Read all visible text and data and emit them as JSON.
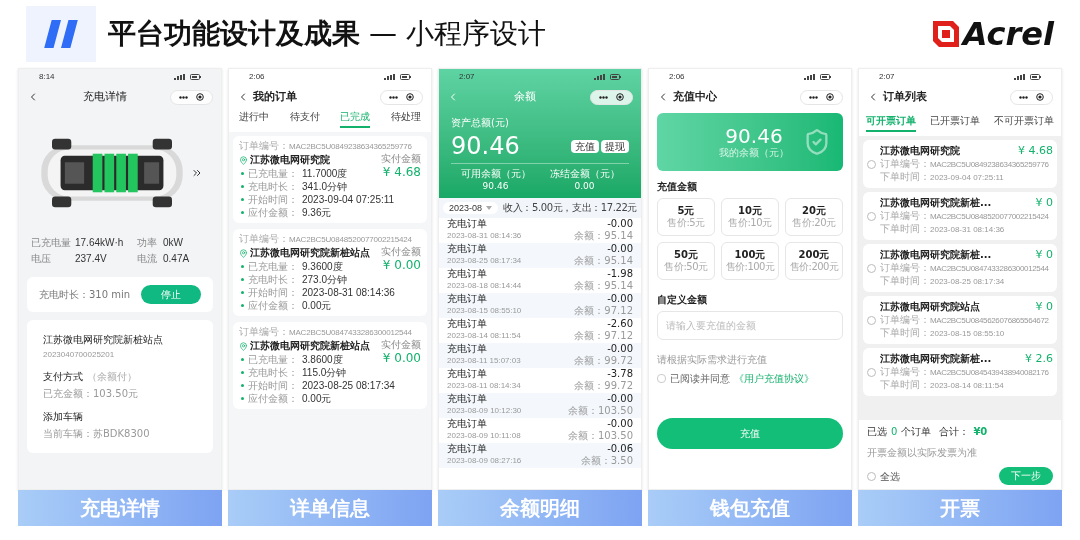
{
  "header": {
    "title": "**平台功能设计及成果** — 小程序设计",
    "logo": "Acrel"
  },
  "screens": [
    {
      "kind": "charge_detail",
      "caption": "充电详情",
      "time": "8:14",
      "title": "充电详情",
      "stats": [
        {
          "label": "已充电量",
          "value": "17.64kW·h"
        },
        {
          "label": "功率",
          "value": "0kW"
        },
        {
          "label": "电压",
          "value": "237.4V"
        },
        {
          "label": "电流",
          "value": "0.47A"
        }
      ],
      "duration": "充电时长：310 min",
      "stop_button": "停止",
      "station": "江苏微电网研究院新桩站点",
      "station_code": "2023040700025201",
      "payment_label": "支付方式",
      "payment_method": "（余额付）",
      "charged_amount": "已充金额：103.50元",
      "vehicle_label": "添加车辆",
      "vehicle": "当前车辆：苏BDK8300"
    },
    {
      "kind": "orders",
      "caption": "详单信息",
      "time": "2:06",
      "title": "我的订单",
      "tabs": [
        {
          "label": "进行中",
          "selected": false
        },
        {
          "label": "待支付",
          "selected": false
        },
        {
          "label": "已完成",
          "selected": true
        },
        {
          "label": "待处理",
          "selected": false
        }
      ],
      "orders": [
        {
          "number_label": "订单编号：",
          "number": "MAC2BC5U0849238634365259776",
          "station": "江苏微电网研究院",
          "paid_label": "实付金额",
          "paid": "¥ 4.68",
          "fields": [
            {
              "label": "已充电量：",
              "value": "11.7000度"
            },
            {
              "label": "充电时长：",
              "value": "341.0分钟"
            },
            {
              "label": "开始时间：",
              "value": "2023-09-04 07:25:11"
            },
            {
              "label": "应付金额：",
              "value": "9.36元"
            }
          ]
        },
        {
          "number_label": "订单编号：",
          "number": "MAC2BC5U0848520077002215424",
          "station": "江苏微电网研究院新桩站点",
          "paid_label": "实付金额",
          "paid": "¥ 0.00",
          "fields": [
            {
              "label": "已充电量：",
              "value": "9.3600度"
            },
            {
              "label": "充电时长：",
              "value": "273.0分钟"
            },
            {
              "label": "开始时间：",
              "value": "2023-08-31 08:14:36"
            },
            {
              "label": "应付金额：",
              "value": "0.00元"
            }
          ]
        },
        {
          "number_label": "订单编号：",
          "number": "MAC2BC5U0847433286300012544",
          "station": "江苏微电网研究院新桩站点",
          "paid_label": "实付金额",
          "paid": "¥ 0.00",
          "fields": [
            {
              "label": "已充电量：",
              "value": "3.8600度"
            },
            {
              "label": "充电时长：",
              "value": "115.0分钟"
            },
            {
              "label": "开始时间：",
              "value": "2023-08-25 08:17:34"
            },
            {
              "label": "应付金额：",
              "value": "0.00元"
            }
          ]
        }
      ]
    },
    {
      "kind": "balance",
      "caption": "余额明细",
      "time": "2:07",
      "title": "余额",
      "total_label": "资产总额(元)",
      "total": "90.46",
      "buttons": [
        "充值",
        "提现"
      ],
      "available_label": "可用余额（元）",
      "available": "90.46",
      "frozen_label": "冻结金额（元）",
      "frozen": "0.00",
      "month": "2023-08",
      "summary": "收入：5.00元，支出：17.22元",
      "rows": [
        {
          "title": "充电订单",
          "time": "2023-08-31 08:14:36",
          "amount": "-0.00",
          "balance": "余额：95.14"
        },
        {
          "title": "充电订单",
          "time": "2023-08-25 08:17:34",
          "amount": "-0.00",
          "balance": "余额：95.14"
        },
        {
          "title": "充电订单",
          "time": "2023-08-18 08:14:44",
          "amount": "-1.98",
          "balance": "余额：95.14"
        },
        {
          "title": "充电订单",
          "time": "2023-08-15 08:55:10",
          "amount": "-0.00",
          "balance": "余额：97.12"
        },
        {
          "title": "充电订单",
          "time": "2023-08-14 08:11:54",
          "amount": "-2.60",
          "balance": "余额：97.12"
        },
        {
          "title": "充电订单",
          "time": "2023-08-11 15:07:03",
          "amount": "-0.00",
          "balance": "余额：99.72"
        },
        {
          "title": "充电订单",
          "time": "2023-08-11 08:14:34",
          "amount": "-3.78",
          "balance": "余额：99.72"
        },
        {
          "title": "充电订单",
          "time": "2023-08-09 10:12:30",
          "amount": "-0.00",
          "balance": "余额：103.50"
        },
        {
          "title": "充电订单",
          "time": "2023-08-09 10:11:08",
          "amount": "-0.00",
          "balance": "余额：103.50"
        },
        {
          "title": "充电订单",
          "time": "2023-08-09 08:27:16",
          "amount": "-0.06",
          "balance": "余额：3.50"
        }
      ]
    },
    {
      "kind": "recharge",
      "caption": "钱包充值",
      "time": "2:06",
      "title": "充值中心",
      "balance": "90.46",
      "balance_label": "我的余额（元）",
      "amount_label": "充值金额",
      "options": [
        {
          "amount": "5元",
          "price": "售价:5元"
        },
        {
          "amount": "10元",
          "price": "售价:10元"
        },
        {
          "amount": "20元",
          "price": "售价:20元"
        },
        {
          "amount": "50元",
          "price": "售价:50元"
        },
        {
          "amount": "100元",
          "price": "售价:100元"
        },
        {
          "amount": "200元",
          "price": "售价:200元"
        }
      ],
      "custom_label": "自定义金额",
      "placeholder": "请输入要充值的金额",
      "hint": "请根据实际需求进行充值",
      "agree_checked": false,
      "agree_text": "已阅读并同意",
      "agreement_link": "《用户充值协议》",
      "submit": "充值"
    },
    {
      "kind": "invoice",
      "caption": "开票",
      "time": "2:07",
      "title": "订单列表",
      "tabs": [
        {
          "label": "可开票订单",
          "selected": true
        },
        {
          "label": "已开票订单",
          "selected": false
        },
        {
          "label": "不可开票订单",
          "selected": false
        }
      ],
      "orders": [
        {
          "station": "江苏微电网研究院",
          "amount": "¥ 4.68",
          "selected": false,
          "number_label": "订单编号：",
          "number": "MAC2BC5U0849238634365259776",
          "time_label": "下单时间：",
          "time": "2023-09-04 07:25:11"
        },
        {
          "station": "江苏微电网研究院新桩...",
          "amount": "¥ 0",
          "selected": false,
          "number_label": "订单编号：",
          "number": "MAC2BC5U0848520077002215424",
          "time_label": "下单时间：",
          "time": "2023-08-31 08:14:36"
        },
        {
          "station": "江苏微电网研究院新桩...",
          "amount": "¥ 0",
          "selected": false,
          "number_label": "订单编号：",
          "number": "MAC2BC5U0847433286300012544",
          "time_label": "下单时间：",
          "time": "2023-08-25 08:17:34"
        },
        {
          "station": "江苏微电网研究院站点",
          "amount": "¥ 0",
          "selected": false,
          "number_label": "订单编号：",
          "number": "MAC2BC5U0845626076865564672",
          "time_label": "下单时间：",
          "time": "2023-08-15 08:55:10"
        },
        {
          "station": "江苏微电网研究院新桩...",
          "amount": "¥ 2.6",
          "selected": false,
          "number_label": "订单编号：",
          "number": "MAC2BC5U0845439438940082176",
          "time_label": "下单时间：",
          "time": "2023-08-14 08:11:54"
        }
      ],
      "selected_prefix": "已选",
      "count": "0",
      "selected_suffix": "个订单",
      "total_label": "合计：",
      "total": "¥0",
      "note": "开票金额以实际发票为准",
      "select_all": "全选",
      "select_all_checked": false,
      "next": "下一步"
    }
  ]
}
